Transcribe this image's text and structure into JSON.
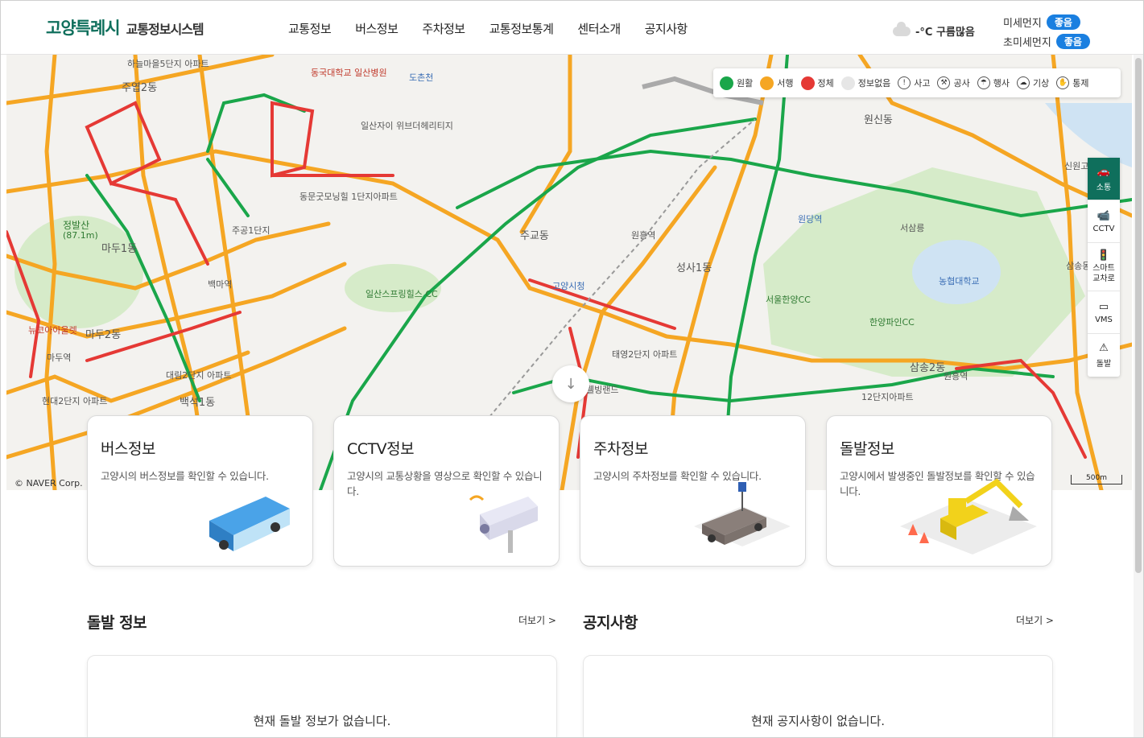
{
  "header": {
    "city": "고양특례시",
    "system": "교통정보시스템",
    "nav": [
      "교통정보",
      "버스정보",
      "주차정보",
      "교통정보통계",
      "센터소개",
      "공지사항"
    ],
    "weather": "-°C 구름많음",
    "fine_dust_label": "미세먼지",
    "fine_dust_value": "좋음",
    "ultra_dust_label": "초미세먼지",
    "ultra_dust_value": "좋음"
  },
  "legend": {
    "items": [
      {
        "label": "원활",
        "color": "#1aa64a"
      },
      {
        "label": "서행",
        "color": "#f5a623"
      },
      {
        "label": "정체",
        "color": "#e53935"
      },
      {
        "label": "정보없음",
        "color": "#e6e6e6"
      }
    ],
    "events": [
      {
        "label": "사고",
        "icon": "accident-icon"
      },
      {
        "label": "공사",
        "icon": "construction-icon"
      },
      {
        "label": "행사",
        "icon": "event-icon"
      },
      {
        "label": "기상",
        "icon": "weather-icon"
      },
      {
        "label": "통제",
        "icon": "control-icon"
      }
    ]
  },
  "sidebar": [
    {
      "label": "소통",
      "icon": "car-icon"
    },
    {
      "label": "CCTV",
      "icon": "cctv-icon"
    },
    {
      "label": "스마트\n교차로",
      "icon": "smart-crossing-icon"
    },
    {
      "label": "VMS",
      "icon": "vms-icon"
    },
    {
      "label": "돌발",
      "icon": "incident-icon"
    }
  ],
  "map": {
    "copyright": "© NAVER Corp.",
    "scale": "500m",
    "labels": [
      "하늘마을5단지 아파트",
      "주엽2동",
      "정발산",
      "(87.1m)",
      "마두1동",
      "마두2동",
      "백마역",
      "주공1단지",
      "백석1동",
      "마두역",
      "일산자이 위브더헤리티지",
      "동국대학교 일산병원",
      "도촌천",
      "일산스프링힐스 CC",
      "주교동",
      "원흥역",
      "성사1동",
      "원당역",
      "서울한양CC",
      "한양파인CC",
      "원신동",
      "서삼릉",
      "농협대학교",
      "삼송2동",
      "원흥역",
      "12단지아파트",
      "동문굿모닝힐 1단지아파트",
      "태영2단지 아파트",
      "고양시청",
      "웰빙랜드",
      "현대2단지 아파트",
      "대림2단지 아파트",
      "뉴코아아울렛",
      "신원고",
      "삼송동"
    ]
  },
  "cards": [
    {
      "title": "버스정보",
      "desc": "고양시의 버스정보를 확인할 수 있습니다."
    },
    {
      "title": "CCTV정보",
      "desc": "고양시의 교통상황을 영상으로 확인할 수 있습니다."
    },
    {
      "title": "주차정보",
      "desc": "고양시의 주차정보를 확인할 수 있습니다."
    },
    {
      "title": "돌발정보",
      "desc": "고양시에서 발생중인 돌발정보를 확인할 수 있습니다."
    }
  ],
  "incident": {
    "title": "돌발 정보",
    "more": "더보기 >",
    "empty": "현재 돌발 정보가 없습니다."
  },
  "notice": {
    "title": "공지사항",
    "more": "더보기 >",
    "empty": "현재 공지사항이 없습니다."
  }
}
